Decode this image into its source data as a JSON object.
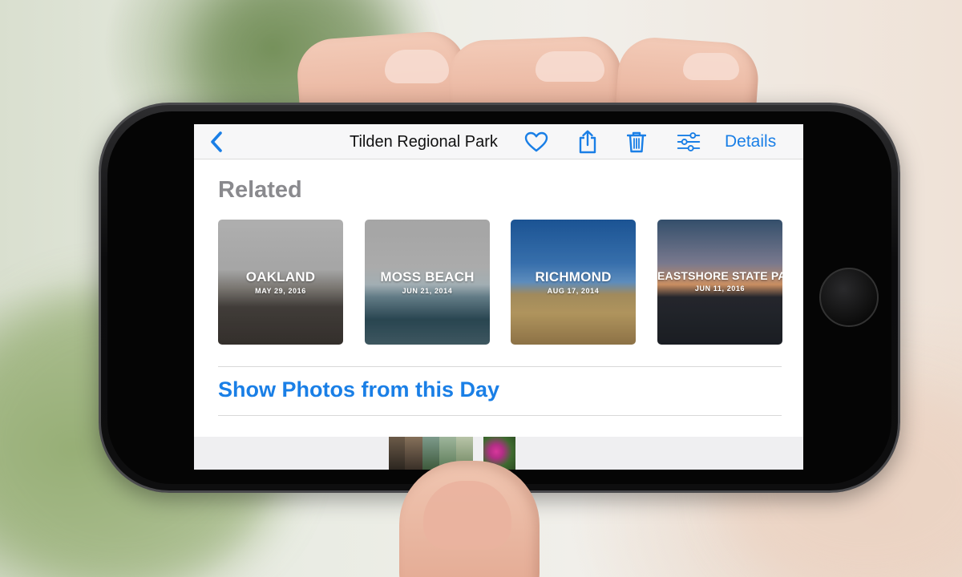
{
  "nav": {
    "title": "Tilden Regional Park",
    "details_label": "Details"
  },
  "related": {
    "heading": "Related",
    "cards": [
      {
        "name": "OAKLAND",
        "date": "MAY 29, 2016"
      },
      {
        "name": "MOSS BEACH",
        "date": "JUN 21, 2014"
      },
      {
        "name": "RICHMOND",
        "date": "AUG 17, 2014"
      },
      {
        "name": "EASTSHORE STATE PARK",
        "date": "JUN 11, 2016"
      }
    ]
  },
  "show_day_label": "Show Photos from this Day",
  "colors": {
    "accent": "#1a7fe6",
    "heading_gray": "#8a8a8e"
  },
  "icons": [
    "chevron-left-icon",
    "heart-icon",
    "share-icon",
    "trash-icon",
    "adjust-icon"
  ]
}
